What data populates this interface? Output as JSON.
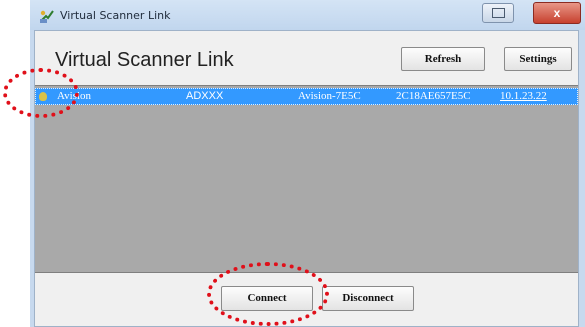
{
  "window": {
    "title": "Virtual Scanner Link",
    "close_label": "x"
  },
  "header": {
    "title": "Virtual Scanner Link",
    "refresh_label": "Refresh",
    "settings_label": "Settings"
  },
  "devices": [
    {
      "name": "Avision",
      "model": "ADXXX",
      "host": "Avision-7E5C",
      "mac": "2C18AE657E5C",
      "ip": "10.1.23.22"
    }
  ],
  "footer": {
    "connect_label": "Connect",
    "disconnect_label": "Disconnect"
  },
  "colors": {
    "selection": "#3399ff",
    "list_background": "#a9a9a9",
    "highlight_marker": "#e0101a"
  }
}
